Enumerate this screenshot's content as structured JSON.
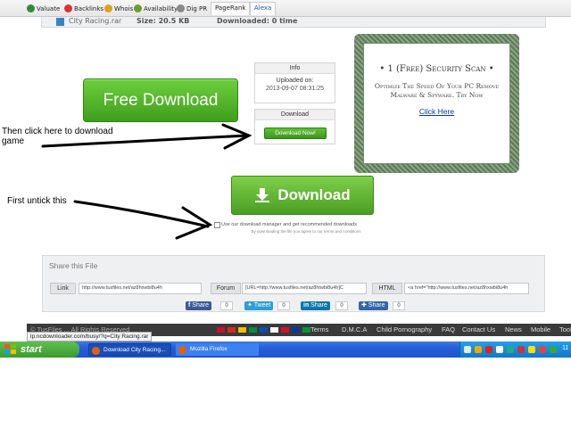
{
  "seo_toolbar": {
    "items": [
      "Valuate",
      "Backlinks",
      "Whois",
      "Availability",
      "Dig PR",
      "PageRank",
      "Alexa"
    ],
    "colors": [
      "#2e8b3a",
      "#d33",
      "#e0a21a",
      "#6a9d2d",
      "#888"
    ]
  },
  "file_strip": {
    "name": "City Racing.rar",
    "size_label": "Size: 20.5 KB",
    "downloaded_label": "Downloaded: 0 time"
  },
  "free_download": {
    "label": "Free Download"
  },
  "info_box": {
    "header": "Info",
    "uploaded_label": "Uploaded on:",
    "uploaded_value": "2013-09-07 08:31:25"
  },
  "download_box": {
    "header": "Download",
    "button": "Download Now!"
  },
  "ad": {
    "title": "• 1 (Free) Security Scan •",
    "body": "Optimize The Speed Of Your PC Remove Malware & Spyware. Try Now",
    "link": "Click Here"
  },
  "annotations": {
    "then_click": "Then click here to download game",
    "first_untick": "First untick this"
  },
  "main_download": {
    "label": "Download"
  },
  "download_manager": {
    "checkbox_label": "Use our download manager and get recommended downloads",
    "terms": "By downloading the file you agree to our terms and conditions"
  },
  "share": {
    "title": "Share this File",
    "link_label": "Link",
    "link_value": "http://www.tusfiles.net/az8hxwbi8u4h",
    "forum_label": "Forum",
    "forum_value": "[URL=http://www.tusfiles.net/az8htwbi8u4h]C",
    "html_label": "HTML",
    "html_value": "<a href=\"http://www.tusfiles.net/az8hxwbi8u4h",
    "social": [
      {
        "label": "Share",
        "count": "0"
      },
      {
        "label": "Tweet",
        "count": "0"
      },
      {
        "label": "Share",
        "count": "0"
      },
      {
        "label": "Share",
        "count": "0"
      }
    ]
  },
  "footer": {
    "copyright": "© TusFiles ... All Rights Reserved",
    "links": [
      "Terms",
      "D.M.C.A",
      "Child Pornography",
      "FAQ",
      "Contact Us",
      "News",
      "Mobile",
      "Tool"
    ]
  },
  "status_url": "lp.ncdownloader.com/busy/?q=City Racing.rar",
  "taskbar": {
    "start_label": "start",
    "tasks": [
      "Download City Racing...",
      "Mozilla Firefox"
    ],
    "clock": "11"
  }
}
